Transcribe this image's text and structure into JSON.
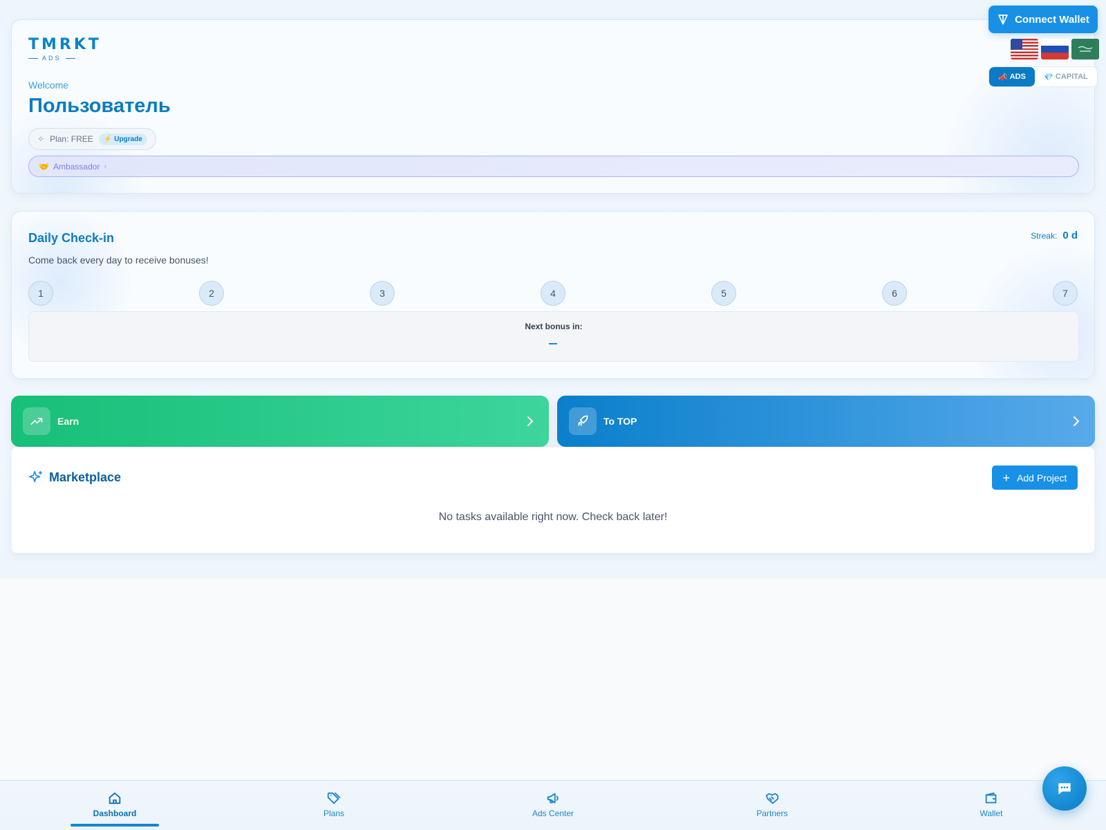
{
  "header": {
    "logo": {
      "main": "TMRKT",
      "sub": "ADS"
    },
    "welcome": "Welcome",
    "username": "Пользователь",
    "plan_label": "Plan: FREE",
    "upgrade_label": "Upgrade",
    "ambassador_label": "Ambassador",
    "connect_wallet_label": "Connect Wallet",
    "flags": [
      "us-flag",
      "ru-flag",
      "sa-flag"
    ],
    "modes": [
      {
        "label": "ADS",
        "icon": "megaphone-icon",
        "active": true
      },
      {
        "label": "CAPITAL",
        "icon": "gem-icon",
        "active": false
      }
    ]
  },
  "checkin": {
    "title": "Daily Check-in",
    "subtitle": "Come back every day to receive bonuses!",
    "streak_label": "Streak:",
    "streak_value": "0 d",
    "days": [
      "1",
      "2",
      "3",
      "4",
      "5",
      "6",
      "7"
    ],
    "next_bonus_label": "Next bonus in:"
  },
  "actions": {
    "earn_label": "Earn",
    "to_top_label": "To TOP"
  },
  "marketplace": {
    "title": "Marketplace",
    "add_project_label": "Add Project",
    "empty_message": "No tasks available right now. Check back later!"
  },
  "nav": {
    "items": [
      {
        "label": "Dashboard",
        "icon": "home-icon",
        "active": true
      },
      {
        "label": "Plans",
        "icon": "tag-icon",
        "active": false
      },
      {
        "label": "Ads Center",
        "icon": "megaphone-icon",
        "active": false
      },
      {
        "label": "Partners",
        "icon": "handshake-icon",
        "active": false
      },
      {
        "label": "Wallet",
        "icon": "wallet-icon",
        "active": false
      }
    ]
  },
  "colors": {
    "accent": "#0b7cc2",
    "earn_gradient_start": "#17bf78",
    "top_gradient_start": "#0a7fcc",
    "ambassador": "#7a84d8"
  }
}
